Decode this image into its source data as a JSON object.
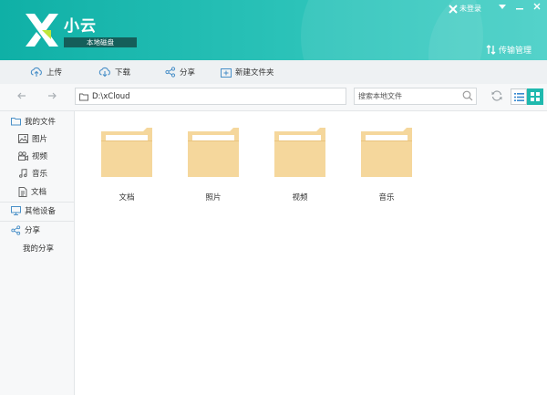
{
  "app": {
    "brand": "小云",
    "subtitle": "本地磁盘",
    "login_label": "未登录",
    "transfer_label": "传输管理",
    "colors": {
      "accent": "#1fb9ae",
      "folder": "#f5d79c",
      "folder_tab": "#e9c47f"
    }
  },
  "toolbar": {
    "upload": "上传",
    "download": "下载",
    "share": "分享",
    "new_folder": "新建文件夹"
  },
  "nav": {
    "path": "D:\\xCloud",
    "search_placeholder": "搜索本地文件"
  },
  "sidebar": {
    "my_files": "我的文件",
    "items": [
      {
        "label": "图片",
        "icon": "image-icon"
      },
      {
        "label": "视频",
        "icon": "video-icon"
      },
      {
        "label": "音乐",
        "icon": "music-icon"
      },
      {
        "label": "文档",
        "icon": "document-icon"
      }
    ],
    "other_devices": "其他设备",
    "share": "分享",
    "my_share": "我的分享"
  },
  "files": [
    {
      "name": "文档"
    },
    {
      "name": "照片"
    },
    {
      "name": "视频"
    },
    {
      "name": "音乐"
    }
  ]
}
